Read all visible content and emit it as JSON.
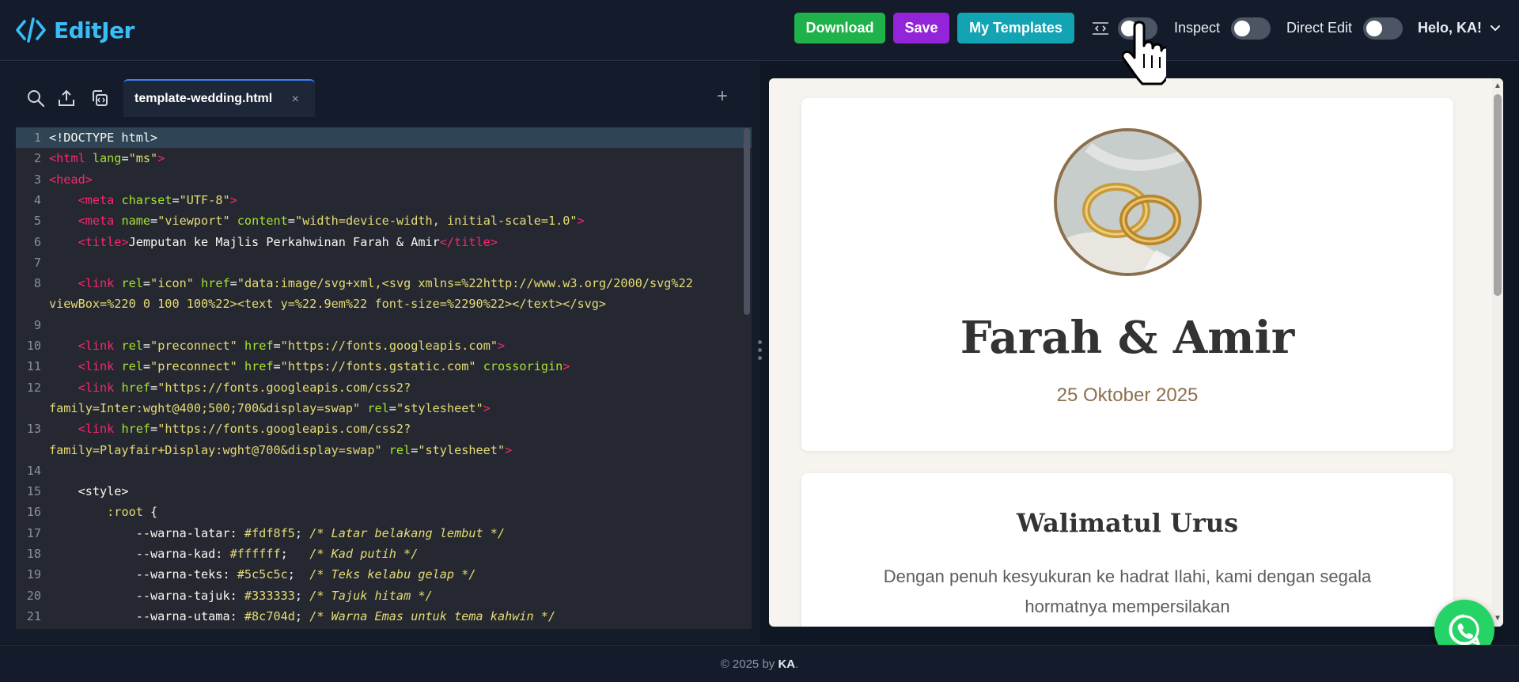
{
  "app": {
    "logo_text": "EditJer",
    "brand_color": "#38bdf8"
  },
  "header": {
    "download_label": "Download",
    "save_label": "Save",
    "templates_label": "My Templates",
    "inspect_label": "Inspect",
    "direct_edit_label": "Direct Edit",
    "user_greeting": "Helo, KA!",
    "view_toggle_on": false,
    "inspect_toggle_on": false,
    "direct_edit_toggle_on": false
  },
  "editor": {
    "tab_name": "template-wedding.html",
    "tab_close": "×",
    "tab_add": "+",
    "lines": [
      {
        "n": "1",
        "segs": [
          [
            "t-plain",
            "<!DOCTYPE html>"
          ]
        ],
        "active": true
      },
      {
        "n": "2",
        "segs": [
          [
            "t-tag",
            "<html "
          ],
          [
            "t-attr",
            "lang"
          ],
          [
            "t-plain",
            "="
          ],
          [
            "t-str",
            "\"ms\""
          ],
          [
            "t-tag",
            ">"
          ]
        ]
      },
      {
        "n": "3",
        "segs": [
          [
            "t-tag",
            "<head>"
          ]
        ]
      },
      {
        "n": "4",
        "segs": [
          [
            "t-plain",
            "    "
          ],
          [
            "t-tag",
            "<meta "
          ],
          [
            "t-attr",
            "charset"
          ],
          [
            "t-plain",
            "="
          ],
          [
            "t-str",
            "\"UTF-8\""
          ],
          [
            "t-tag",
            ">"
          ]
        ]
      },
      {
        "n": "5",
        "segs": [
          [
            "t-plain",
            "    "
          ],
          [
            "t-tag",
            "<meta "
          ],
          [
            "t-attr",
            "name"
          ],
          [
            "t-plain",
            "="
          ],
          [
            "t-str",
            "\"viewport\""
          ],
          [
            "t-plain",
            " "
          ],
          [
            "t-attr",
            "content"
          ],
          [
            "t-plain",
            "="
          ],
          [
            "t-str",
            "\"width=device-width, initial-scale=1.0\""
          ],
          [
            "t-tag",
            ">"
          ]
        ]
      },
      {
        "n": "6",
        "segs": [
          [
            "t-plain",
            "    "
          ],
          [
            "t-tag",
            "<title>"
          ],
          [
            "t-plain",
            "Jemputan ke Majlis Perkahwinan Farah & Amir"
          ],
          [
            "t-tag",
            "</title>"
          ]
        ]
      },
      {
        "n": "7",
        "segs": []
      },
      {
        "n": "8",
        "segs": [
          [
            "t-plain",
            "    "
          ],
          [
            "t-tag",
            "<link "
          ],
          [
            "t-attr",
            "rel"
          ],
          [
            "t-plain",
            "="
          ],
          [
            "t-str",
            "\"icon\""
          ],
          [
            "t-plain",
            " "
          ],
          [
            "t-attr",
            "href"
          ],
          [
            "t-plain",
            "="
          ],
          [
            "t-str",
            "\"data:image/svg+xml,<svg xmlns=%22http://www.w3.org/2000/svg%22"
          ]
        ]
      },
      {
        "n": "",
        "segs": [
          [
            "t-str",
            "viewBox=%220 0 100 100%22><text y=%22.9em%22 font-size=%2290%22></text></svg>"
          ]
        ]
      },
      {
        "n": "9",
        "segs": []
      },
      {
        "n": "10",
        "segs": [
          [
            "t-plain",
            "    "
          ],
          [
            "t-tag",
            "<link "
          ],
          [
            "t-attr",
            "rel"
          ],
          [
            "t-plain",
            "="
          ],
          [
            "t-str",
            "\"preconnect\""
          ],
          [
            "t-plain",
            " "
          ],
          [
            "t-attr",
            "href"
          ],
          [
            "t-plain",
            "="
          ],
          [
            "t-str",
            "\"https://fonts.googleapis.com\""
          ],
          [
            "t-tag",
            ">"
          ]
        ]
      },
      {
        "n": "11",
        "segs": [
          [
            "t-plain",
            "    "
          ],
          [
            "t-tag",
            "<link "
          ],
          [
            "t-attr",
            "rel"
          ],
          [
            "t-plain",
            "="
          ],
          [
            "t-str",
            "\"preconnect\""
          ],
          [
            "t-plain",
            " "
          ],
          [
            "t-attr",
            "href"
          ],
          [
            "t-plain",
            "="
          ],
          [
            "t-str",
            "\"https://fonts.gstatic.com\""
          ],
          [
            "t-plain",
            " "
          ],
          [
            "t-attr",
            "crossorigin"
          ],
          [
            "t-tag",
            ">"
          ]
        ]
      },
      {
        "n": "12",
        "segs": [
          [
            "t-plain",
            "    "
          ],
          [
            "t-tag",
            "<link "
          ],
          [
            "t-attr",
            "href"
          ],
          [
            "t-plain",
            "="
          ],
          [
            "t-str",
            "\"https://fonts.googleapis.com/css2?"
          ]
        ]
      },
      {
        "n": "",
        "segs": [
          [
            "t-str",
            "family=Inter:wght@400;500;700&display=swap\""
          ],
          [
            "t-plain",
            " "
          ],
          [
            "t-attr",
            "rel"
          ],
          [
            "t-plain",
            "="
          ],
          [
            "t-str",
            "\"stylesheet\""
          ],
          [
            "t-tag",
            ">"
          ]
        ]
      },
      {
        "n": "13",
        "segs": [
          [
            "t-plain",
            "    "
          ],
          [
            "t-tag",
            "<link "
          ],
          [
            "t-attr",
            "href"
          ],
          [
            "t-plain",
            "="
          ],
          [
            "t-str",
            "\"https://fonts.googleapis.com/css2?"
          ]
        ]
      },
      {
        "n": "",
        "segs": [
          [
            "t-str",
            "family=Playfair+Display:wght@700&display=swap\""
          ],
          [
            "t-plain",
            " "
          ],
          [
            "t-attr",
            "rel"
          ],
          [
            "t-plain",
            "="
          ],
          [
            "t-str",
            "\"stylesheet\""
          ],
          [
            "t-tag",
            ">"
          ]
        ]
      },
      {
        "n": "14",
        "segs": []
      },
      {
        "n": "15",
        "segs": [
          [
            "t-plain",
            "    <style>"
          ]
        ]
      },
      {
        "n": "16",
        "segs": [
          [
            "t-plain",
            "        "
          ],
          [
            "t-str",
            ":root"
          ],
          [
            "t-plain",
            " {"
          ]
        ]
      },
      {
        "n": "17",
        "segs": [
          [
            "t-plain",
            "            --warna-latar: "
          ],
          [
            "t-str",
            "#fdf8f5"
          ],
          [
            "t-plain",
            "; "
          ],
          [
            "t-cm",
            "/* Latar belakang lembut */"
          ]
        ]
      },
      {
        "n": "18",
        "segs": [
          [
            "t-plain",
            "            --warna-kad: "
          ],
          [
            "t-str",
            "#ffffff"
          ],
          [
            "t-plain",
            ";   "
          ],
          [
            "t-cm",
            "/* Kad putih */"
          ]
        ]
      },
      {
        "n": "19",
        "segs": [
          [
            "t-plain",
            "            --warna-teks: "
          ],
          [
            "t-str",
            "#5c5c5c"
          ],
          [
            "t-plain",
            ";  "
          ],
          [
            "t-cm",
            "/* Teks kelabu gelap */"
          ]
        ]
      },
      {
        "n": "20",
        "segs": [
          [
            "t-plain",
            "            --warna-tajuk: "
          ],
          [
            "t-str",
            "#333333"
          ],
          [
            "t-plain",
            "; "
          ],
          [
            "t-cm",
            "/* Tajuk hitam */"
          ]
        ]
      },
      {
        "n": "21",
        "segs": [
          [
            "t-plain",
            "            --warna-utama: "
          ],
          [
            "t-str",
            "#8c704d"
          ],
          [
            "t-plain",
            "; "
          ],
          [
            "t-cm",
            "/* Warna Emas untuk tema kahwin */"
          ]
        ]
      }
    ]
  },
  "preview": {
    "couple_name": "Farah & Amir",
    "wedding_date": "25 Oktober 2025",
    "walimah_title": "Walimatul Urus",
    "walimah_text": "Dengan penuh kesyukuran ke hadrat Ilahi, kami dengan segala hormatnya mempersilakan",
    "accent_color": "#8c704d"
  },
  "footer": {
    "prefix": "© 2025 by ",
    "author": "KA",
    "suffix": "."
  }
}
